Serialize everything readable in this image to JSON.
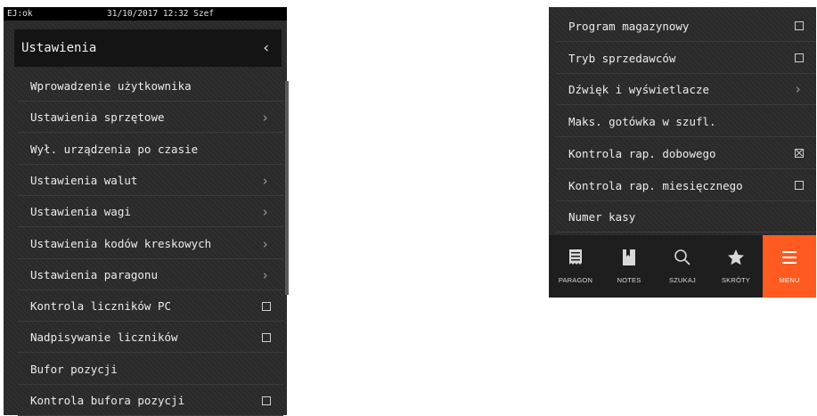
{
  "left_panel": {
    "status": {
      "left": "EJ:ok",
      "center": "31/10/2017 12:32 Szef"
    },
    "header": {
      "title": "Ustawienia",
      "back": "‹"
    },
    "items": [
      {
        "label": "Wprowadzenie użytkownika",
        "control": "none"
      },
      {
        "label": "Ustawienia sprzętowe",
        "control": "chevron"
      },
      {
        "label": "Wył. urządzenia po czasie",
        "control": "none"
      },
      {
        "label": "Ustawienia walut",
        "control": "chevron"
      },
      {
        "label": "Ustawienia wagi",
        "control": "chevron"
      },
      {
        "label": "Ustawienia kodów kreskowych",
        "control": "chevron"
      },
      {
        "label": "Ustawienia paragonu",
        "control": "chevron"
      },
      {
        "label": "Kontrola liczników PC",
        "control": "checkbox",
        "checked": false
      },
      {
        "label": "Nadpisywanie liczników",
        "control": "checkbox",
        "checked": false
      },
      {
        "label": "Bufor pozycji",
        "control": "none"
      },
      {
        "label": "Kontrola bufora pozycji",
        "control": "checkbox",
        "checked": false
      }
    ],
    "chevron": "›"
  },
  "right_panel": {
    "items": [
      {
        "label": "Program magazynowy",
        "control": "checkbox",
        "checked": false
      },
      {
        "label": "Tryb sprzedawców",
        "control": "checkbox",
        "checked": false
      },
      {
        "label": "Dźwięk i wyświetlacze",
        "control": "chevron"
      },
      {
        "label": "Maks. gotówka w szufl.",
        "control": "none"
      },
      {
        "label": "Kontrola rap. dobowego",
        "control": "checkbox",
        "checked": true
      },
      {
        "label": "Kontrola rap. miesięcznego",
        "control": "checkbox",
        "checked": false
      },
      {
        "label": "Numer kasy",
        "control": "none"
      }
    ],
    "chevron": "›",
    "tabs": [
      {
        "label": "PARAGON",
        "icon": "receipt-icon",
        "active": false
      },
      {
        "label": "NOTES",
        "icon": "notebook-icon",
        "active": false
      },
      {
        "label": "SZUKAJ",
        "icon": "search-icon",
        "active": false
      },
      {
        "label": "SKRÓTY",
        "icon": "star-icon",
        "active": false
      },
      {
        "label": "MENU",
        "icon": "hamburger-menu-icon",
        "active": true
      }
    ]
  },
  "colors": {
    "background": "#2a2a2a",
    "statusbar": "#000000",
    "header": "#141414",
    "tabbar": "#1e1e1e",
    "accent": "#ff5a1f"
  }
}
